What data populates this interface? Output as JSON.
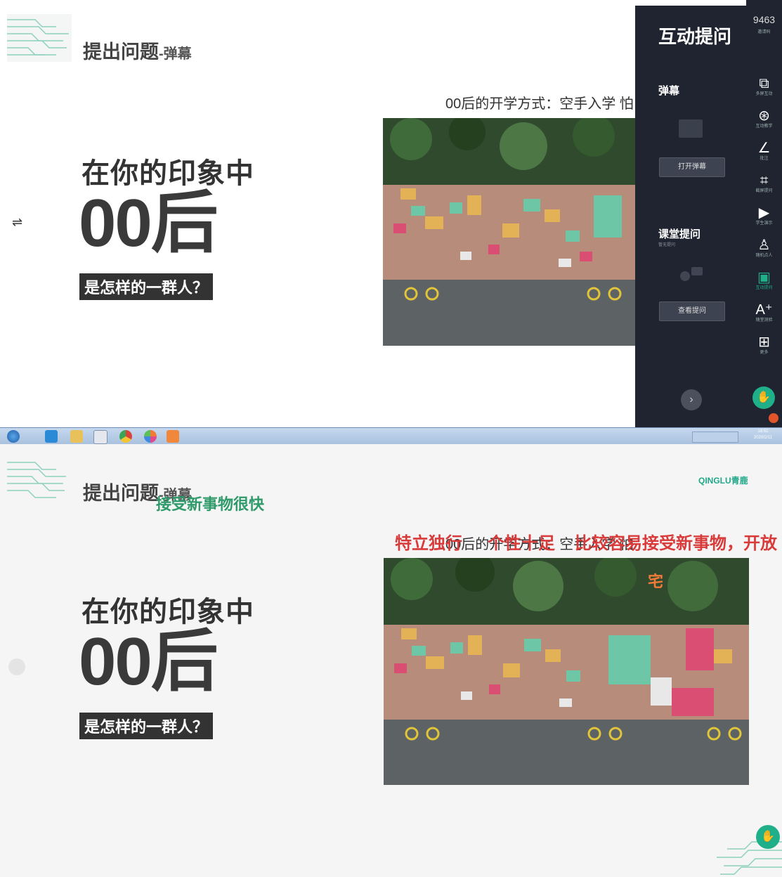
{
  "top_slide": {
    "title": "提出问题",
    "title_suffix": "-弹幕",
    "lead": "在你的印象中",
    "big": "00后",
    "tag": "是怎样的一群人？",
    "caption": "00后的开学方式：空手入学  怕",
    "swap_glyph": "⇌"
  },
  "panel": {
    "title": "互动提问",
    "barrage_section": "弹幕",
    "open_barrage_button": "打开弹幕",
    "class_question_section": "课堂提问",
    "class_question_hint": "暂无提问",
    "view_questions_button": "查看提问",
    "room_code": "9463",
    "room_code_label": "邀请码"
  },
  "toolbar": [
    {
      "label": "多屏互动",
      "icon": "window-icon"
    },
    {
      "label": "互动教学",
      "icon": "palette-icon"
    },
    {
      "label": "批注",
      "icon": "pen-icon"
    },
    {
      "label": "截屏提问",
      "icon": "crop-icon"
    },
    {
      "label": "学生演示",
      "icon": "play-icon"
    },
    {
      "label": "随机点人",
      "icon": "person-icon"
    },
    {
      "label": "互动提问",
      "icon": "chat-icon"
    },
    {
      "label": "随堂测验",
      "icon": "font-plus-icon"
    },
    {
      "label": "更多",
      "icon": "grid-icon"
    }
  ],
  "taskbar": {
    "clock_time": "18:51",
    "clock_date": "2020/2/11"
  },
  "bottom_slide": {
    "title": "提出问题",
    "title_suffix": "-弹幕",
    "brand": "QINGLU青鹿",
    "lead": "在你的印象中",
    "big": "00后",
    "tag": "是怎样的一群人？",
    "caption": "00后的开学方式：空手入学  怕",
    "danmaku": [
      {
        "text": "接受新事物很快",
        "color": "#2f9a6a"
      },
      {
        "text": "特立独行",
        "color": "#d93a3a"
      },
      {
        "text": "个性十足",
        "color": "#d93a3a"
      },
      {
        "text": "比较容易接受新事物，开放",
        "color": "#d93a3a"
      },
      {
        "text": "宅",
        "color": "#f07a3a"
      }
    ]
  },
  "colors": {
    "panel_bg": "#1f2430",
    "accent_green": "#1fb08a",
    "danmaku_red": "#d93a3a",
    "danmaku_green": "#2f9a6a"
  }
}
